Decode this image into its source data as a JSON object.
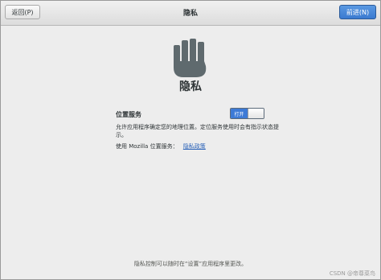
{
  "header": {
    "back_label": "返回(P)",
    "title": "隐私",
    "next_label": "前进(N)"
  },
  "main": {
    "icon": "hand-icon",
    "title": "隐私",
    "location": {
      "label": "位置服务",
      "switch_state": "打开",
      "description": "允许应用程序确定您的地理位置。定位服务使用时会有指示状态提示。",
      "use_prefix": "使用 Mozilla 位置服务：",
      "policy_link": "隐私政策"
    },
    "footer": "隐私控制可以随时在“设置”应用程序里更改。"
  },
  "watermark": "CSDN @帝尊菜鸟",
  "colors": {
    "accent": "#3d7ad6",
    "background": "#ededed",
    "icon": "#5f6a6e"
  }
}
